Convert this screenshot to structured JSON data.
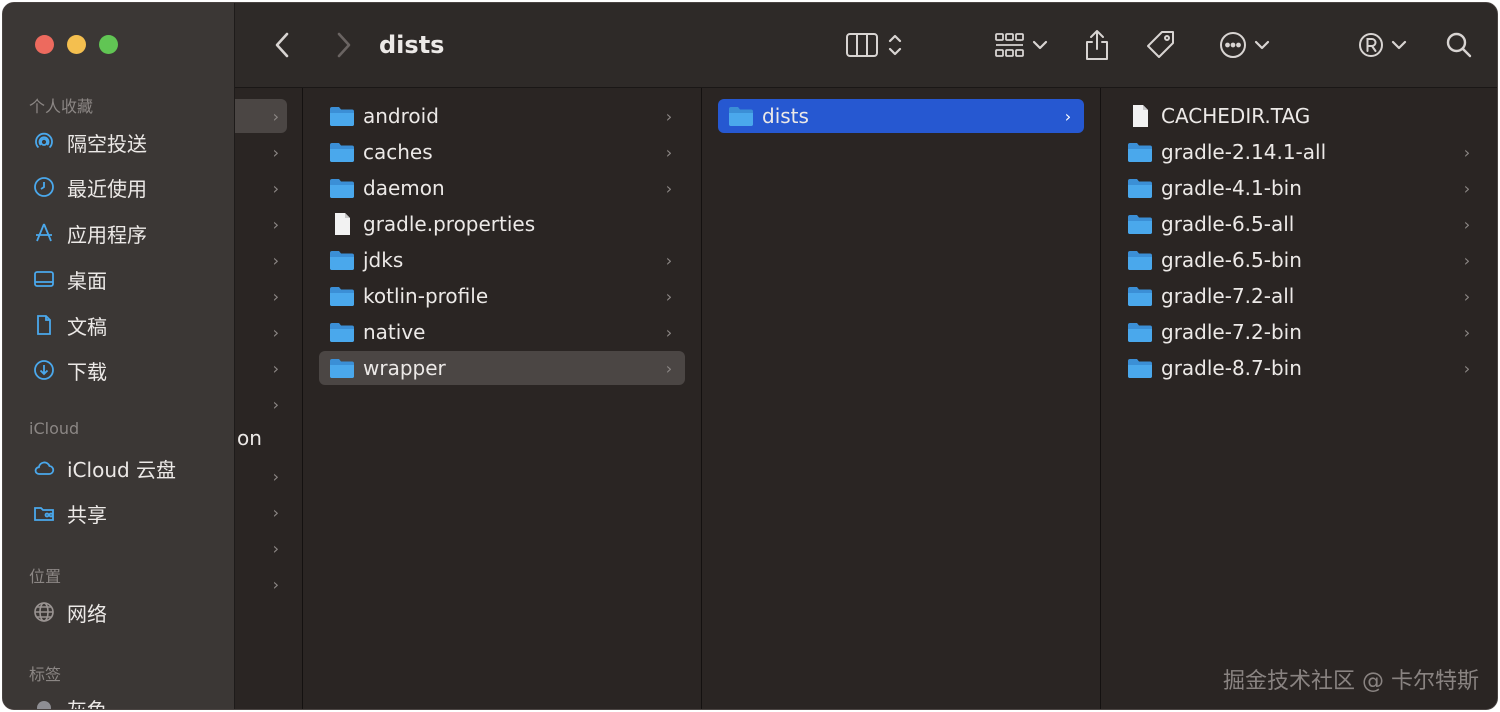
{
  "window": {
    "title": "dists"
  },
  "sidebar": {
    "sections": [
      {
        "label": "个人收藏"
      },
      {
        "label": "iCloud"
      },
      {
        "label": "位置"
      },
      {
        "label": "标签"
      }
    ],
    "favorites": [
      {
        "label": "隔空投送",
        "icon": "airdrop-icon"
      },
      {
        "label": "最近使用",
        "icon": "clock-icon"
      },
      {
        "label": "应用程序",
        "icon": "apps-icon"
      },
      {
        "label": "桌面",
        "icon": "desktop-icon"
      },
      {
        "label": "文稿",
        "icon": "document-icon"
      },
      {
        "label": "下载",
        "icon": "download-icon"
      }
    ],
    "icloud": [
      {
        "label": "iCloud 云盘",
        "icon": "cloud-icon"
      },
      {
        "label": "共享",
        "icon": "shared-folder-icon"
      }
    ],
    "locations": [
      {
        "label": "网络",
        "icon": "network-icon"
      }
    ],
    "tags": [
      {
        "label": "灰色",
        "color": "#8e8e93"
      }
    ]
  },
  "columns": {
    "col0": {
      "partial_text": "on"
    },
    "col1": [
      {
        "name": "android",
        "type": "folder"
      },
      {
        "name": "caches",
        "type": "folder"
      },
      {
        "name": "daemon",
        "type": "folder"
      },
      {
        "name": "gradle.properties",
        "type": "file"
      },
      {
        "name": "jdks",
        "type": "folder"
      },
      {
        "name": "kotlin-profile",
        "type": "folder"
      },
      {
        "name": "native",
        "type": "folder"
      },
      {
        "name": "wrapper",
        "type": "folder",
        "selected": true
      }
    ],
    "col2": [
      {
        "name": "dists",
        "type": "folder",
        "selected": true
      }
    ],
    "col3": [
      {
        "name": "CACHEDIR.TAG",
        "type": "file"
      },
      {
        "name": "gradle-2.14.1-all",
        "type": "folder"
      },
      {
        "name": "gradle-4.1-bin",
        "type": "folder"
      },
      {
        "name": "gradle-6.5-all",
        "type": "folder"
      },
      {
        "name": "gradle-6.5-bin",
        "type": "folder"
      },
      {
        "name": "gradle-7.2-all",
        "type": "folder"
      },
      {
        "name": "gradle-7.2-bin",
        "type": "folder"
      },
      {
        "name": "gradle-8.7-bin",
        "type": "folder"
      }
    ]
  },
  "colors": {
    "folder": "#4aa8ec",
    "selection_blue": "#2658d1",
    "selection_gray": "#4b4644"
  },
  "watermark": "掘金技术社区 @ 卡尔特斯"
}
